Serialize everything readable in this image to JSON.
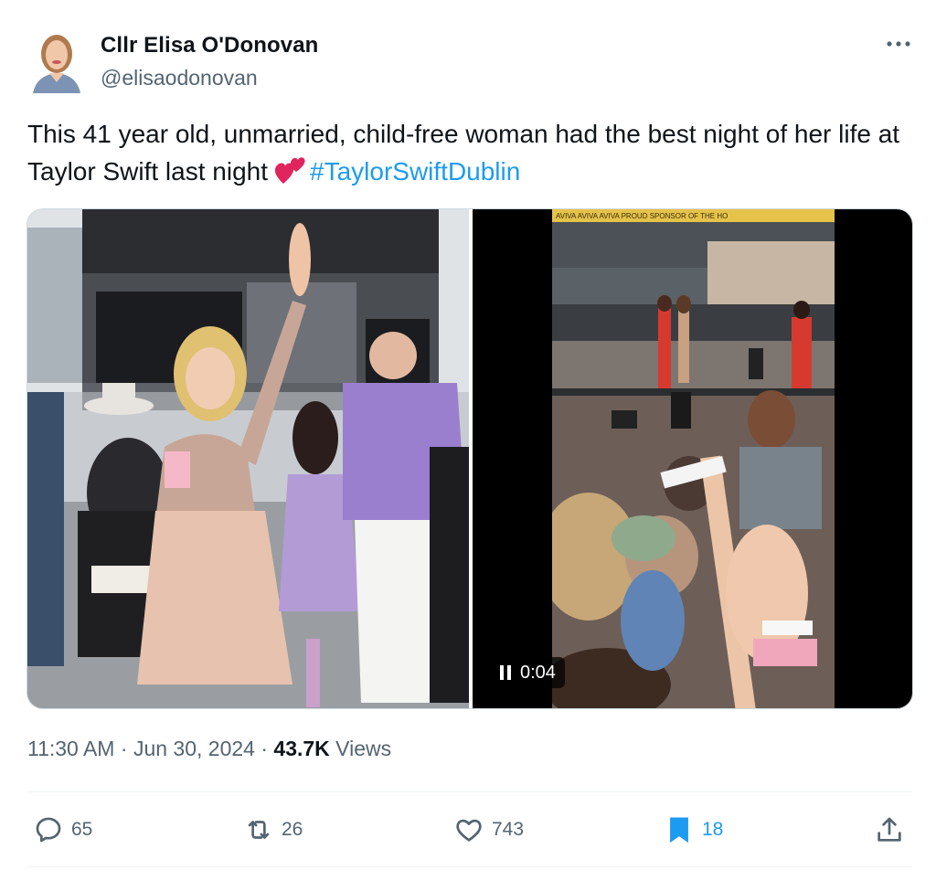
{
  "author": {
    "name": "Cllr Elisa O'Donovan",
    "handle": "@elisaodonovan",
    "avatar_icon": "profile-photo"
  },
  "tweet": {
    "text_before": "This 41 year old, unmarried, child-free woman had the best night of her life at Taylor Swift last night",
    "emoji": "two-hearts",
    "hashtag": "#TaylorSwiftDublin"
  },
  "media": {
    "left_photo": "woman-waving-at-concert-photo",
    "right_video": "concert-crowd-video",
    "video_time": "0:04",
    "stage_banner": "AVIVA AVIVA AVIVA PROUD SPONSOR OF THE HO"
  },
  "meta": {
    "time": "11:30 AM",
    "date": "Jun 30, 2024",
    "views_count": "43.7K",
    "views_label": "Views",
    "separator": "·"
  },
  "actions": {
    "replies": "65",
    "reposts": "26",
    "likes": "743",
    "bookmarks": "18"
  },
  "colors": {
    "link": "#1d9bf0",
    "secondary_text": "#536471",
    "primary_text": "#0f1419",
    "bookmark_active": "#1d9bf0"
  }
}
